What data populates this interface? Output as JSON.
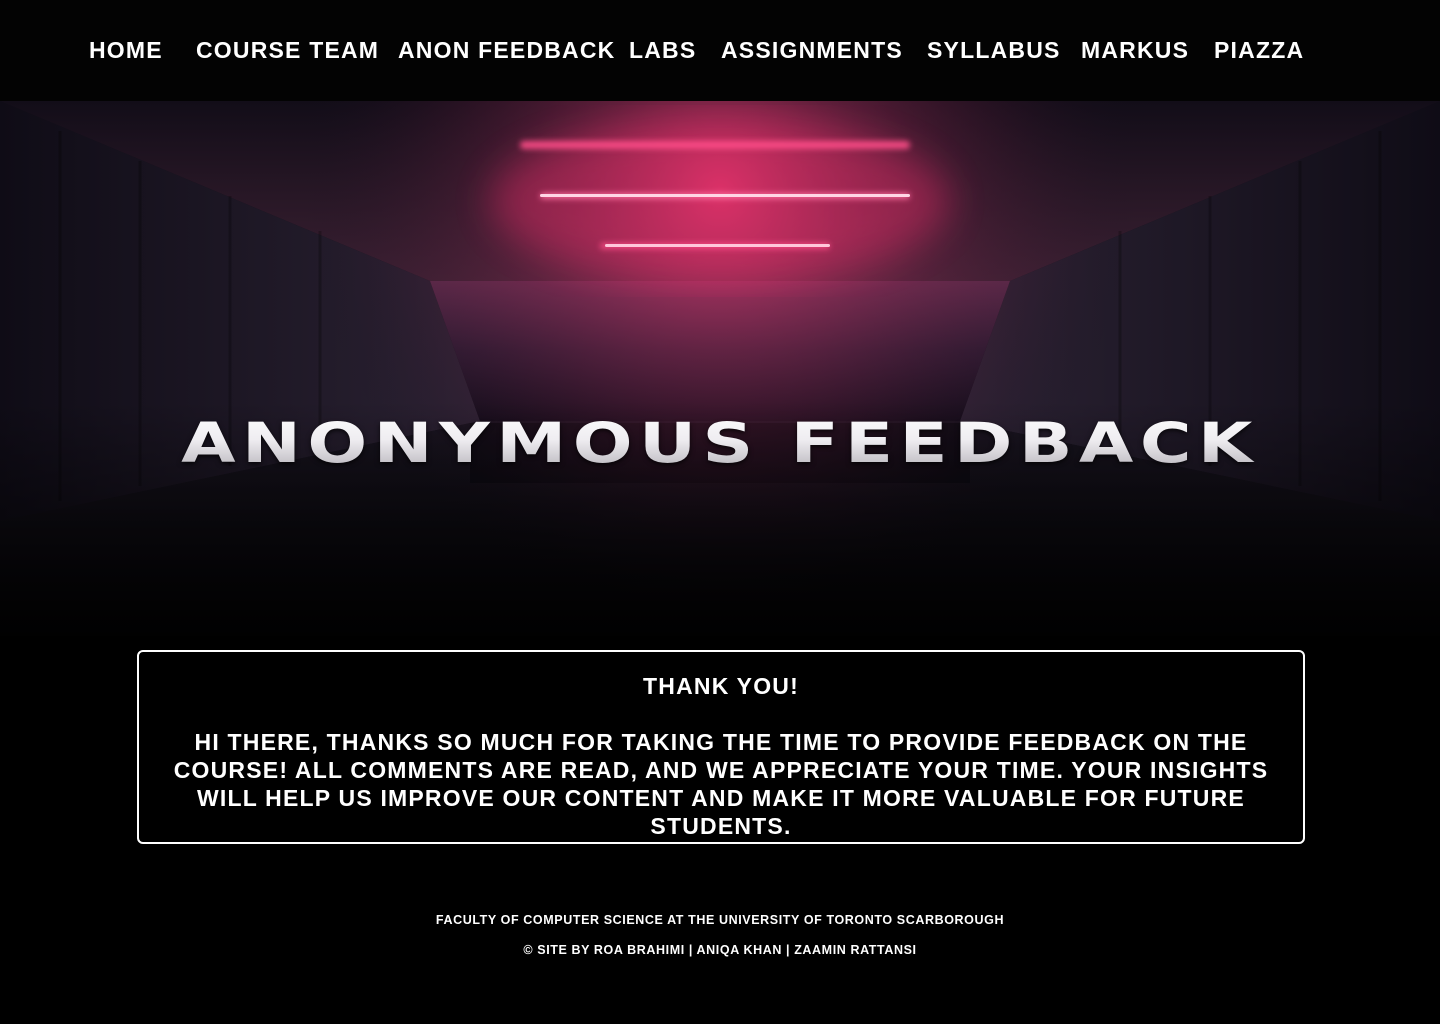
{
  "nav": {
    "items": [
      {
        "label": "HOME"
      },
      {
        "label": "COURSE TEAM"
      },
      {
        "label": "ANON FEEDBACK"
      },
      {
        "label": "LABS"
      },
      {
        "label": "ASSIGNMENTS"
      },
      {
        "label": "SYLLABUS"
      },
      {
        "label": "MARKUS"
      },
      {
        "label": "PIAZZA"
      }
    ]
  },
  "hero": {
    "title": "ANONYMOUS FEEDBACK"
  },
  "message": {
    "title": "THANK YOU!",
    "body": "HI THERE, THANKS SO MUCH FOR TAKING THE TIME TO PROVIDE FEEDBACK ON THE COURSE! ALL COMMENTS ARE READ, AND WE APPRECIATE YOUR TIME. YOUR INSIGHTS WILL HELP US IMPROVE OUR CONTENT AND MAKE IT MORE VALUABLE FOR FUTURE STUDENTS."
  },
  "footer": {
    "line1": "FACULTY OF COMPUTER SCIENCE AT THE UNIVERSITY OF TORONTO SCARBOROUGH",
    "line2": "© SITE BY ROA BRAHIMI | ANIQA KHAN | ZAAMIN RATTANSI"
  },
  "colors": {
    "background": "#000000",
    "text": "#ffffff",
    "neon_accent": "#ff2a6d"
  }
}
